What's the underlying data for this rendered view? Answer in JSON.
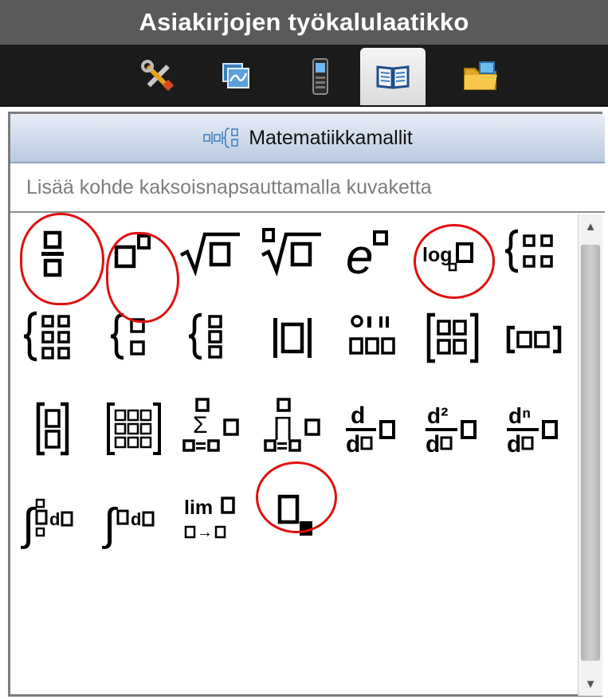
{
  "window": {
    "title": "Asiakirjojen työkalulaatikko"
  },
  "tabs": [
    {
      "name": "tools",
      "icon": "tools-icon"
    },
    {
      "name": "variables",
      "icon": "graph-icon"
    },
    {
      "name": "handheld",
      "icon": "handheld-icon"
    },
    {
      "name": "utilities",
      "icon": "book-icon",
      "active": true
    },
    {
      "name": "content",
      "icon": "folder-icon"
    }
  ],
  "section": {
    "title": "Matematiikkamallit",
    "icon": "math-templates-icon"
  },
  "hint": "Lisää kohde kaksoisnapsauttamalla kuvaketta",
  "templates": {
    "lim": "lim",
    "arrow": "→",
    "d": "d",
    "d2": "d²",
    "dn": "dⁿ",
    "e": "e",
    "log": "log",
    "dd": "d",
    "root": "√",
    "sigma": "Σ",
    "pi": "∏",
    "integral": "∫",
    "factorial": "!!"
  },
  "colors": {
    "annotation": "#e01010",
    "title_bar": "#5a5a5a",
    "tab_bar": "#1b1b1b",
    "header": "#b9c9df"
  }
}
